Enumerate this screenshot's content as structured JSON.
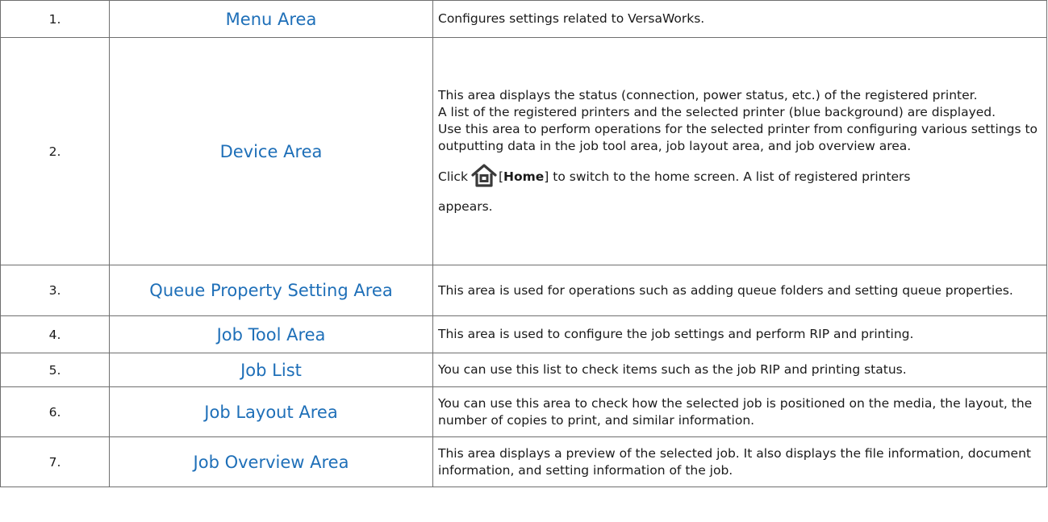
{
  "rows": [
    {
      "num": "1.",
      "name": "Menu Area",
      "desc": "Configures settings related to VersaWorks."
    },
    {
      "num": "2.",
      "name": "Device Area",
      "desc_lines": [
        "This area displays the status (connection, power status, etc.) of the registered printer.",
        "A list of the registered printers and the selected printer (blue background) are displayed.",
        "Use this area to perform operations for the selected printer from configuring various settings to outputting data in the job tool area, job layout area, and job overview area."
      ],
      "home_before": "Click",
      "home_icon": "home-icon",
      "home_label": "Home",
      "home_after": "to switch to the home screen. A list of registered printers",
      "home_tail": "appears."
    },
    {
      "num": "3.",
      "name": "Queue Property Setting Area",
      "desc": "This area is used for operations such as adding queue folders and setting queue properties."
    },
    {
      "num": "4.",
      "name": "Job Tool Area",
      "desc": "This area is used to configure the job settings and perform RIP and printing."
    },
    {
      "num": "5.",
      "name": "Job List",
      "desc": "You can use this list to check items such as the job RIP and printing status."
    },
    {
      "num": "6.",
      "name": "Job Layout Area",
      "desc": "You can use this area to check how the selected job is positioned on the media, the layout, the number of copies to print, and similar information."
    },
    {
      "num": "7.",
      "name": "Job Overview Area",
      "desc": "This area displays a preview of the selected job. It also displays the file information, document information, and setting information of the job."
    }
  ],
  "colors": {
    "link": "#1e6fb8",
    "border": "#6f6f6f",
    "icon": "#3a3a3a"
  }
}
